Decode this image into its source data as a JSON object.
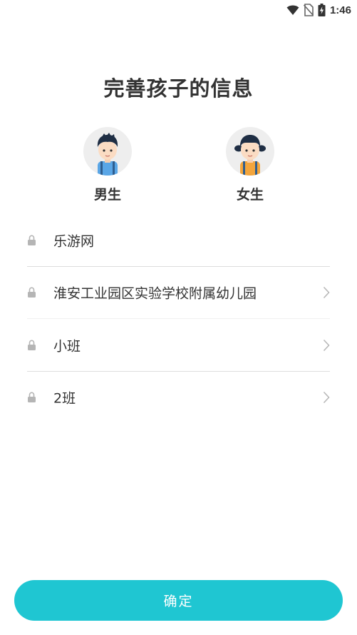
{
  "status_bar": {
    "time": "1:46",
    "icons": [
      "wifi-icon",
      "no-sim-icon",
      "battery-charging-icon"
    ]
  },
  "header": {
    "title": "完善孩子的信息"
  },
  "gender": {
    "boy_label": "男生",
    "girl_label": "女生",
    "boy_icon": "boy-avatar-icon",
    "girl_icon": "girl-avatar-icon"
  },
  "form": {
    "rows": [
      {
        "value": "乐游网",
        "icon": "lock-icon",
        "has_chevron": false
      },
      {
        "value": "淮安工业园区实验学校附属幼儿园",
        "icon": "lock-icon",
        "has_chevron": true
      },
      {
        "value": "小班",
        "icon": "lock-icon",
        "has_chevron": true
      },
      {
        "value": "2班",
        "icon": "lock-icon",
        "has_chevron": true
      }
    ]
  },
  "footer": {
    "confirm_label": "确定"
  },
  "colors": {
    "accent": "#1fc6d2",
    "text": "#333333",
    "divider": "#dddddd",
    "icon_gray": "#b5b5b5",
    "avatar_bg": "#eeeeee"
  }
}
